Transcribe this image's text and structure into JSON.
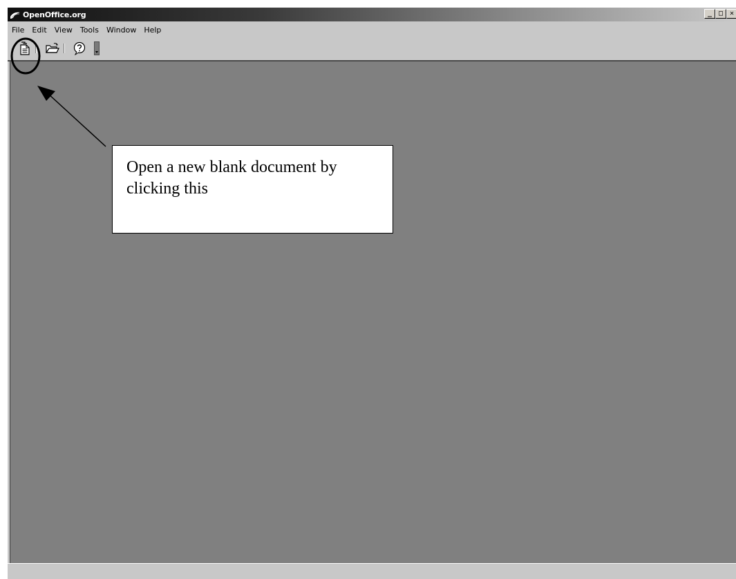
{
  "window": {
    "title": "OpenOffice.org",
    "controls": {
      "minimize": "_",
      "maximize": "□",
      "close": "✕"
    }
  },
  "menu": {
    "items": [
      {
        "label": "File"
      },
      {
        "label": "Edit"
      },
      {
        "label": "View"
      },
      {
        "label": "Tools"
      },
      {
        "label": "Window"
      },
      {
        "label": "Help"
      }
    ]
  },
  "toolbar": {
    "buttons": [
      {
        "icon": "new-document-icon"
      },
      {
        "icon": "open-folder-icon"
      },
      {
        "icon": "help-icon"
      },
      {
        "icon": "toolbar-options-arrow-icon"
      }
    ]
  },
  "annotation": {
    "callout_text": "Open a new blank document by clicking this"
  },
  "colors": {
    "workspace": "#808080",
    "chrome": "#c8c8c8",
    "title_gradient_start": "#101010"
  }
}
